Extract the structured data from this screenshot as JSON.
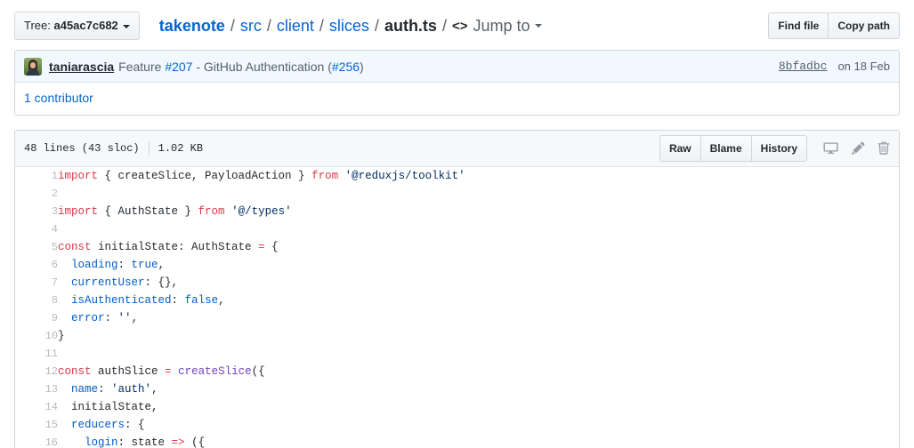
{
  "topbar": {
    "tree_label": "Tree:",
    "tree_sha": "a45ac7c682",
    "breadcrumb": {
      "repo": "takenote",
      "segments": [
        "src",
        "client",
        "slices"
      ],
      "file": "auth.ts",
      "separator": "/"
    },
    "jump_to_label": "Jump to",
    "jump_to_icon": "code-icon",
    "find_file_label": "Find file",
    "copy_path_label": "Copy path"
  },
  "commit": {
    "author": "taniarascia",
    "message_prefix": "Feature ",
    "issue_ref": "#207",
    "message_middle": " - GitHub Authentication (",
    "pr_ref": "#256",
    "message_suffix": ")",
    "sha": "8bfadbc",
    "date": "on 18 Feb",
    "contributors_label": "1 contributor"
  },
  "file": {
    "lines_label": "48 lines (43 sloc)",
    "size_label": "1.02 KB",
    "raw_label": "Raw",
    "blame_label": "Blame",
    "history_label": "History",
    "icons": [
      "desktop-icon",
      "pencil-icon",
      "trash-icon"
    ]
  },
  "colors": {
    "link": "#0366d6",
    "keyword": "#d73a49",
    "string": "#032f62",
    "property": "#005cc5",
    "function": "#6f42c1",
    "muted": "#586069",
    "commit_bg": "#f1f8ff",
    "file_head_bg": "#f6f8fa",
    "border": "#d1d5da"
  },
  "code": {
    "language": "typescript",
    "lines": [
      {
        "n": 1,
        "tokens": [
          {
            "t": "import",
            "c": "k"
          },
          {
            "t": " { createSlice, PayloadAction } ",
            "c": "t"
          },
          {
            "t": "from",
            "c": "k"
          },
          {
            "t": " ",
            "c": "t"
          },
          {
            "t": "'@reduxjs/toolkit'",
            "c": "s"
          }
        ]
      },
      {
        "n": 2,
        "tokens": []
      },
      {
        "n": 3,
        "tokens": [
          {
            "t": "import",
            "c": "k"
          },
          {
            "t": " { AuthState } ",
            "c": "t"
          },
          {
            "t": "from",
            "c": "k"
          },
          {
            "t": " ",
            "c": "t"
          },
          {
            "t": "'@/types'",
            "c": "s"
          }
        ]
      },
      {
        "n": 4,
        "tokens": []
      },
      {
        "n": 5,
        "tokens": [
          {
            "t": "const",
            "c": "k"
          },
          {
            "t": " initialState: AuthState ",
            "c": "t"
          },
          {
            "t": "=",
            "c": "k"
          },
          {
            "t": " {",
            "c": "t"
          }
        ]
      },
      {
        "n": 6,
        "tokens": [
          {
            "t": "  ",
            "c": "t"
          },
          {
            "t": "loading",
            "c": "p"
          },
          {
            "t": ": ",
            "c": "t"
          },
          {
            "t": "true",
            "c": "p"
          },
          {
            "t": ",",
            "c": "t"
          }
        ]
      },
      {
        "n": 7,
        "tokens": [
          {
            "t": "  ",
            "c": "t"
          },
          {
            "t": "currentUser",
            "c": "p"
          },
          {
            "t": ": {},",
            "c": "t"
          }
        ]
      },
      {
        "n": 8,
        "tokens": [
          {
            "t": "  ",
            "c": "t"
          },
          {
            "t": "isAuthenticated",
            "c": "p"
          },
          {
            "t": ": ",
            "c": "t"
          },
          {
            "t": "false",
            "c": "p"
          },
          {
            "t": ",",
            "c": "t"
          }
        ]
      },
      {
        "n": 9,
        "tokens": [
          {
            "t": "  ",
            "c": "t"
          },
          {
            "t": "error",
            "c": "p"
          },
          {
            "t": ": ",
            "c": "t"
          },
          {
            "t": "''",
            "c": "s"
          },
          {
            "t": ",",
            "c": "t"
          }
        ]
      },
      {
        "n": 10,
        "tokens": [
          {
            "t": "}",
            "c": "t"
          }
        ]
      },
      {
        "n": 11,
        "tokens": []
      },
      {
        "n": 12,
        "tokens": [
          {
            "t": "const",
            "c": "k"
          },
          {
            "t": " authSlice ",
            "c": "t"
          },
          {
            "t": "=",
            "c": "k"
          },
          {
            "t": " ",
            "c": "t"
          },
          {
            "t": "createSlice",
            "c": "f"
          },
          {
            "t": "({",
            "c": "t"
          }
        ]
      },
      {
        "n": 13,
        "tokens": [
          {
            "t": "  ",
            "c": "t"
          },
          {
            "t": "name",
            "c": "p"
          },
          {
            "t": ": ",
            "c": "t"
          },
          {
            "t": "'auth'",
            "c": "s"
          },
          {
            "t": ",",
            "c": "t"
          }
        ]
      },
      {
        "n": 14,
        "tokens": [
          {
            "t": "  initialState,",
            "c": "t"
          }
        ]
      },
      {
        "n": 15,
        "tokens": [
          {
            "t": "  ",
            "c": "t"
          },
          {
            "t": "reducers",
            "c": "p"
          },
          {
            "t": ": {",
            "c": "t"
          }
        ]
      },
      {
        "n": 16,
        "tokens": [
          {
            "t": "    ",
            "c": "t"
          },
          {
            "t": "login",
            "c": "p"
          },
          {
            "t": ": state ",
            "c": "t"
          },
          {
            "t": "=>",
            "c": "k"
          },
          {
            "t": " ({",
            "c": "t"
          }
        ]
      }
    ]
  }
}
